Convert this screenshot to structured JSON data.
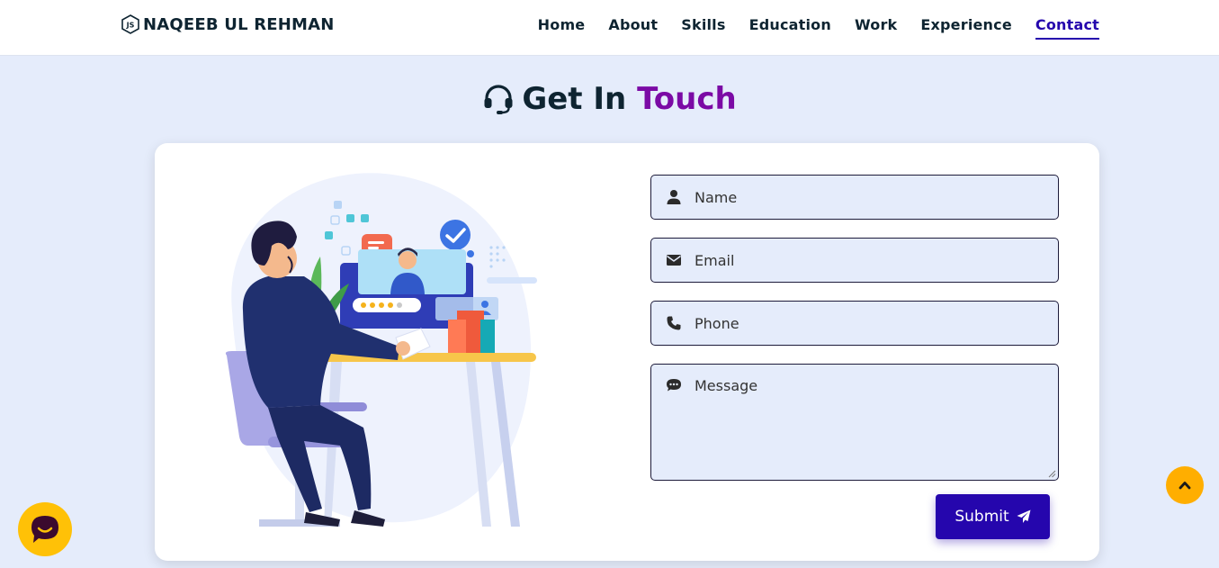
{
  "header": {
    "brand": "NAQEEB UL REHMAN",
    "nav": [
      {
        "label": "Home",
        "active": false
      },
      {
        "label": "About",
        "active": false
      },
      {
        "label": "Skills",
        "active": false
      },
      {
        "label": "Education",
        "active": false
      },
      {
        "label": "Work",
        "active": false
      },
      {
        "label": "Experience",
        "active": false
      },
      {
        "label": "Contact",
        "active": true
      }
    ]
  },
  "section": {
    "title_main": "Get In",
    "title_accent": "Touch",
    "icon": "headset-icon"
  },
  "form": {
    "name_placeholder": "Name",
    "email_placeholder": "Email",
    "phone_placeholder": "Phone",
    "message_placeholder": "Message",
    "submit_label": "Submit"
  },
  "colors": {
    "accent": "#2506ad",
    "title_accent": "#7b0aa5",
    "background": "#e5ecfb",
    "floating_button": "#ffae00"
  },
  "icons": {
    "brand": "js-badge-icon",
    "name": "user-icon",
    "email": "envelope-icon",
    "phone": "phone-icon",
    "message": "comment-dots-icon",
    "submit": "paper-plane-icon",
    "scroll_top": "chevron-up-icon",
    "chat": "chat-icon"
  }
}
